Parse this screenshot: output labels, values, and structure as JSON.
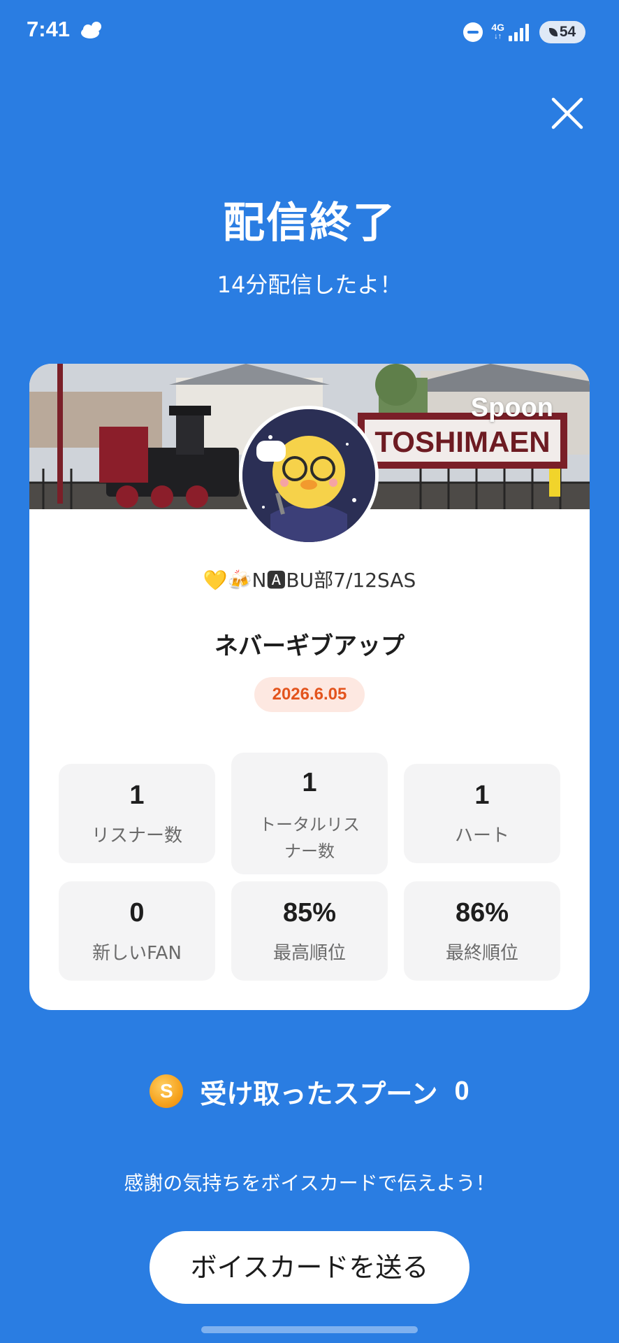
{
  "status_bar": {
    "time": "7:41",
    "weather_icon": "cloud-sun-icon",
    "network_top": "4G",
    "network_bottom": "↓↑",
    "battery": "54",
    "signal_level": 4
  },
  "header": {
    "close_icon": "close-icon",
    "title": "配信終了",
    "subtitle": "14分配信したよ！"
  },
  "card": {
    "brand": "Spoon",
    "banner_sign": "TOSHIMAEN",
    "username": "💛🍻N🅰BU部7/12SAS",
    "stream_title": "ネバーギブアップ",
    "date": "2026.6.05",
    "stats": [
      {
        "value": "1",
        "label": "リスナー数"
      },
      {
        "value": "1",
        "label": "トータルリス\nナー数"
      },
      {
        "value": "1",
        "label": "ハート"
      },
      {
        "value": "0",
        "label": "新しいFAN"
      },
      {
        "value": "85%",
        "label": "最高順位"
      },
      {
        "value": "86%",
        "label": "最終順位"
      }
    ]
  },
  "spoons": {
    "icon_letter": "S",
    "label": "受け取ったスプーン",
    "count": "0"
  },
  "footer": {
    "message": "感謝の気持ちをボイスカードで伝えよう！",
    "button_label": "ボイスカードを送る"
  },
  "colors": {
    "background": "#2a7de2",
    "date_text": "#e3541d",
    "date_bg": "#fde8e1",
    "spoon_coin": "#f6a21d"
  }
}
